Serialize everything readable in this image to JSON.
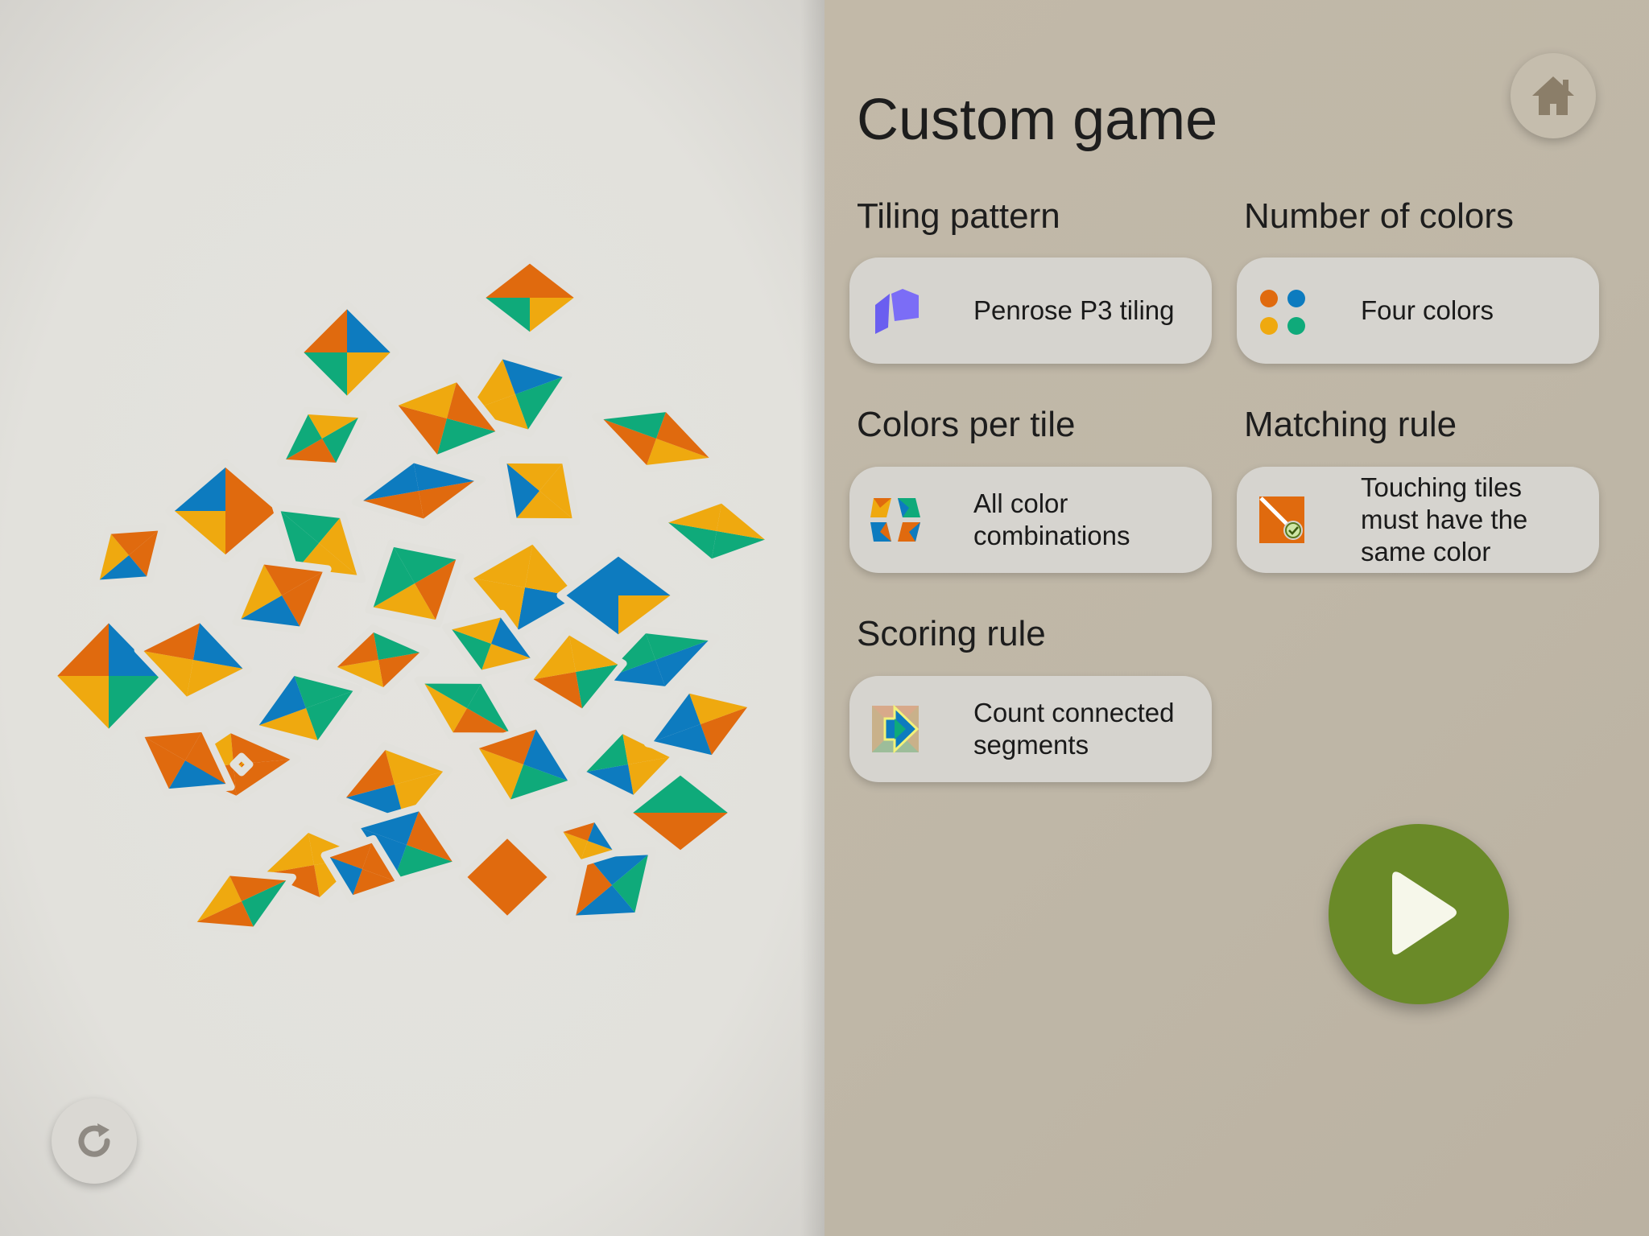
{
  "screen": {
    "title": "Custom game"
  },
  "settings": {
    "tiling": {
      "label": "Tiling pattern",
      "value": "Penrose P3 tiling",
      "icon": "penrose-rhombus-icon"
    },
    "colors": {
      "label": "Number of colors",
      "value": "Four colors",
      "icon": "four-dots-icon"
    },
    "colors_per_tile": {
      "label": "Colors per tile",
      "value": "All color combinations",
      "icon": "color-combinations-icon"
    },
    "matching": {
      "label": "Matching rule",
      "value": "Touching tiles must have the same color",
      "icon": "matching-tiles-icon"
    },
    "scoring": {
      "label": "Scoring rule",
      "value": "Count connected segments",
      "icon": "connected-segments-icon"
    }
  },
  "buttons": {
    "home": "home-icon",
    "play": "play-icon",
    "reset": "refresh-icon"
  },
  "palette": {
    "orange": "#e06a0e",
    "yellow": "#efa90f",
    "green": "#0faa7a",
    "blue": "#0d7bbf",
    "play_green": "#6a8a28",
    "right_bg": "#c0b8a8",
    "left_bg": "#e2e1dc"
  }
}
